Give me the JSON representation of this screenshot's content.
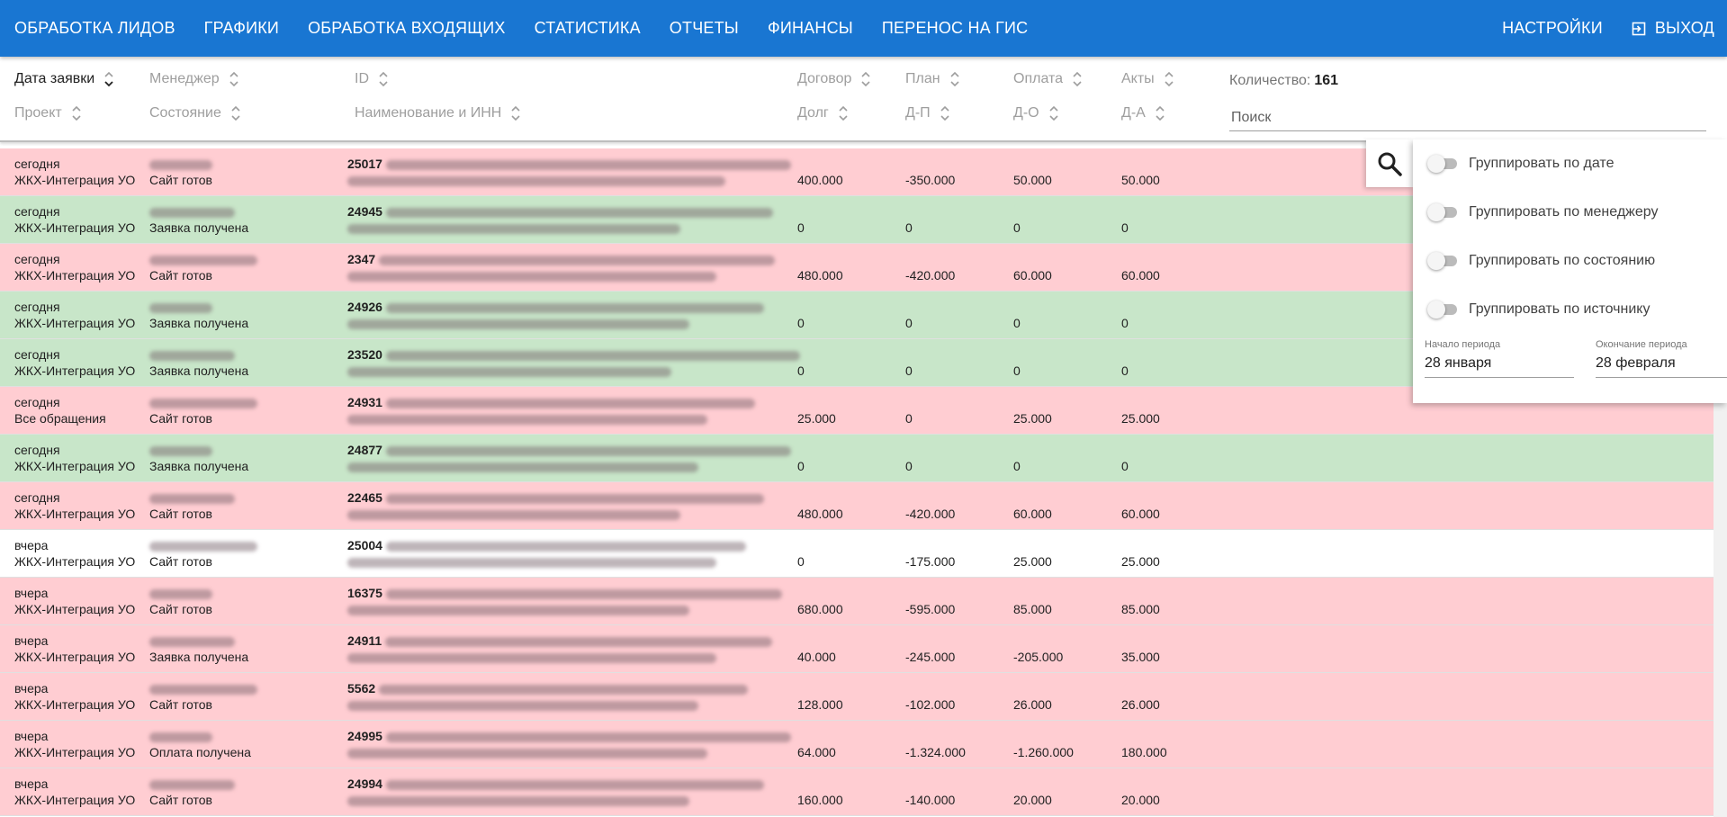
{
  "nav": {
    "items": [
      "ОБРАБОТКА ЛИДОВ",
      "ГРАФИКИ",
      "ОБРАБОТКА ВХОДЯЩИХ",
      "СТАТИСТИКА",
      "ОТЧЕТЫ",
      "ФИНАНСЫ",
      "ПЕРЕНОС НА ГИС"
    ],
    "settings": "НАСТРОЙКИ",
    "logout": "ВЫХОД"
  },
  "header": {
    "date": "Дата заявки",
    "manager": "Менеджер",
    "id": "ID",
    "contract": "Договор",
    "plan": "План",
    "payment": "Оплата",
    "acts": "Акты",
    "project": "Проект",
    "state": "Состояние",
    "name_inn": "Наименование и ИНН",
    "debt": "Долг",
    "dp": "Д-П",
    "do": "Д-О",
    "da": "Д-А",
    "count_label": "Количество:",
    "count_value": "161",
    "search_placeholder": "Поиск"
  },
  "panel": {
    "group_by_date": "Группировать по дате",
    "group_by_manager": "Группировать по менеджеру",
    "group_by_state": "Группировать по состоянию",
    "group_by_source": "Группировать по источнику",
    "period_start_label": "Начало периода",
    "period_start_value": "28 января",
    "period_end_label": "Окончание периода",
    "period_end_value": "28 февраля"
  },
  "rows": [
    {
      "color": "pink",
      "date": "сегодня",
      "project": "ЖКХ-Интеграция УО",
      "state": "Сайт готов",
      "id": "25017",
      "contract": "400.000",
      "plan": "-350.000",
      "payment": "50.000",
      "acts": "50.000"
    },
    {
      "color": "green",
      "date": "сегодня",
      "project": "ЖКХ-Интеграция УО",
      "state": "Заявка получена",
      "id": "24945",
      "contract": "0",
      "plan": "0",
      "payment": "0",
      "acts": "0"
    },
    {
      "color": "pink",
      "date": "сегодня",
      "project": "ЖКХ-Интеграция УО",
      "state": "Сайт готов",
      "id": "2347",
      "contract": "480.000",
      "plan": "-420.000",
      "payment": "60.000",
      "acts": "60.000"
    },
    {
      "color": "green",
      "date": "сегодня",
      "project": "ЖКХ-Интеграция УО",
      "state": "Заявка получена",
      "id": "24926",
      "contract": "0",
      "plan": "0",
      "payment": "0",
      "acts": "0"
    },
    {
      "color": "green",
      "date": "сегодня",
      "project": "ЖКХ-Интеграция УО",
      "state": "Заявка получена",
      "id": "23520",
      "contract": "0",
      "plan": "0",
      "payment": "0",
      "acts": "0"
    },
    {
      "color": "pink",
      "date": "сегодня",
      "project": "Все обращения",
      "state": "Сайт готов",
      "id": "24931",
      "contract": "25.000",
      "plan": "0",
      "payment": "25.000",
      "acts": "25.000"
    },
    {
      "color": "green",
      "date": "сегодня",
      "project": "ЖКХ-Интеграция УО",
      "state": "Заявка получена",
      "id": "24877",
      "contract": "0",
      "plan": "0",
      "payment": "0",
      "acts": "0"
    },
    {
      "color": "pink",
      "date": "сегодня",
      "project": "ЖКХ-Интеграция УО",
      "state": "Сайт готов",
      "id": "22465",
      "contract": "480.000",
      "plan": "-420.000",
      "payment": "60.000",
      "acts": "60.000"
    },
    {
      "color": "white",
      "date": "вчера",
      "project": "ЖКХ-Интеграция УО",
      "state": "Сайт готов",
      "id": "25004",
      "contract": "0",
      "plan": "-175.000",
      "payment": "25.000",
      "acts": "25.000"
    },
    {
      "color": "pink",
      "date": "вчера",
      "project": "ЖКХ-Интеграция УО",
      "state": "Сайт готов",
      "id": "16375",
      "contract": "680.000",
      "plan": "-595.000",
      "payment": "85.000",
      "acts": "85.000"
    },
    {
      "color": "pink",
      "date": "вчера",
      "project": "ЖКХ-Интеграция УО",
      "state": "Заявка получена",
      "id": "24911",
      "contract": "40.000",
      "plan": "-245.000",
      "payment": "-205.000",
      "acts": "35.000"
    },
    {
      "color": "pink",
      "date": "вчера",
      "project": "ЖКХ-Интеграция УО",
      "state": "Сайт готов",
      "id": "5562",
      "contract": "128.000",
      "plan": "-102.000",
      "payment": "26.000",
      "acts": "26.000"
    },
    {
      "color": "pink",
      "date": "вчера",
      "project": "ЖКХ-Интеграция УО",
      "state": "Оплата получена",
      "id": "24995",
      "contract": "64.000",
      "plan": "-1.324.000",
      "payment": "-1.260.000",
      "acts": "180.000"
    },
    {
      "color": "pink",
      "date": "вчера",
      "project": "ЖКХ-Интеграция УО",
      "state": "Сайт готов",
      "id": "24994",
      "contract": "160.000",
      "plan": "-140.000",
      "payment": "20.000",
      "acts": "20.000"
    }
  ]
}
